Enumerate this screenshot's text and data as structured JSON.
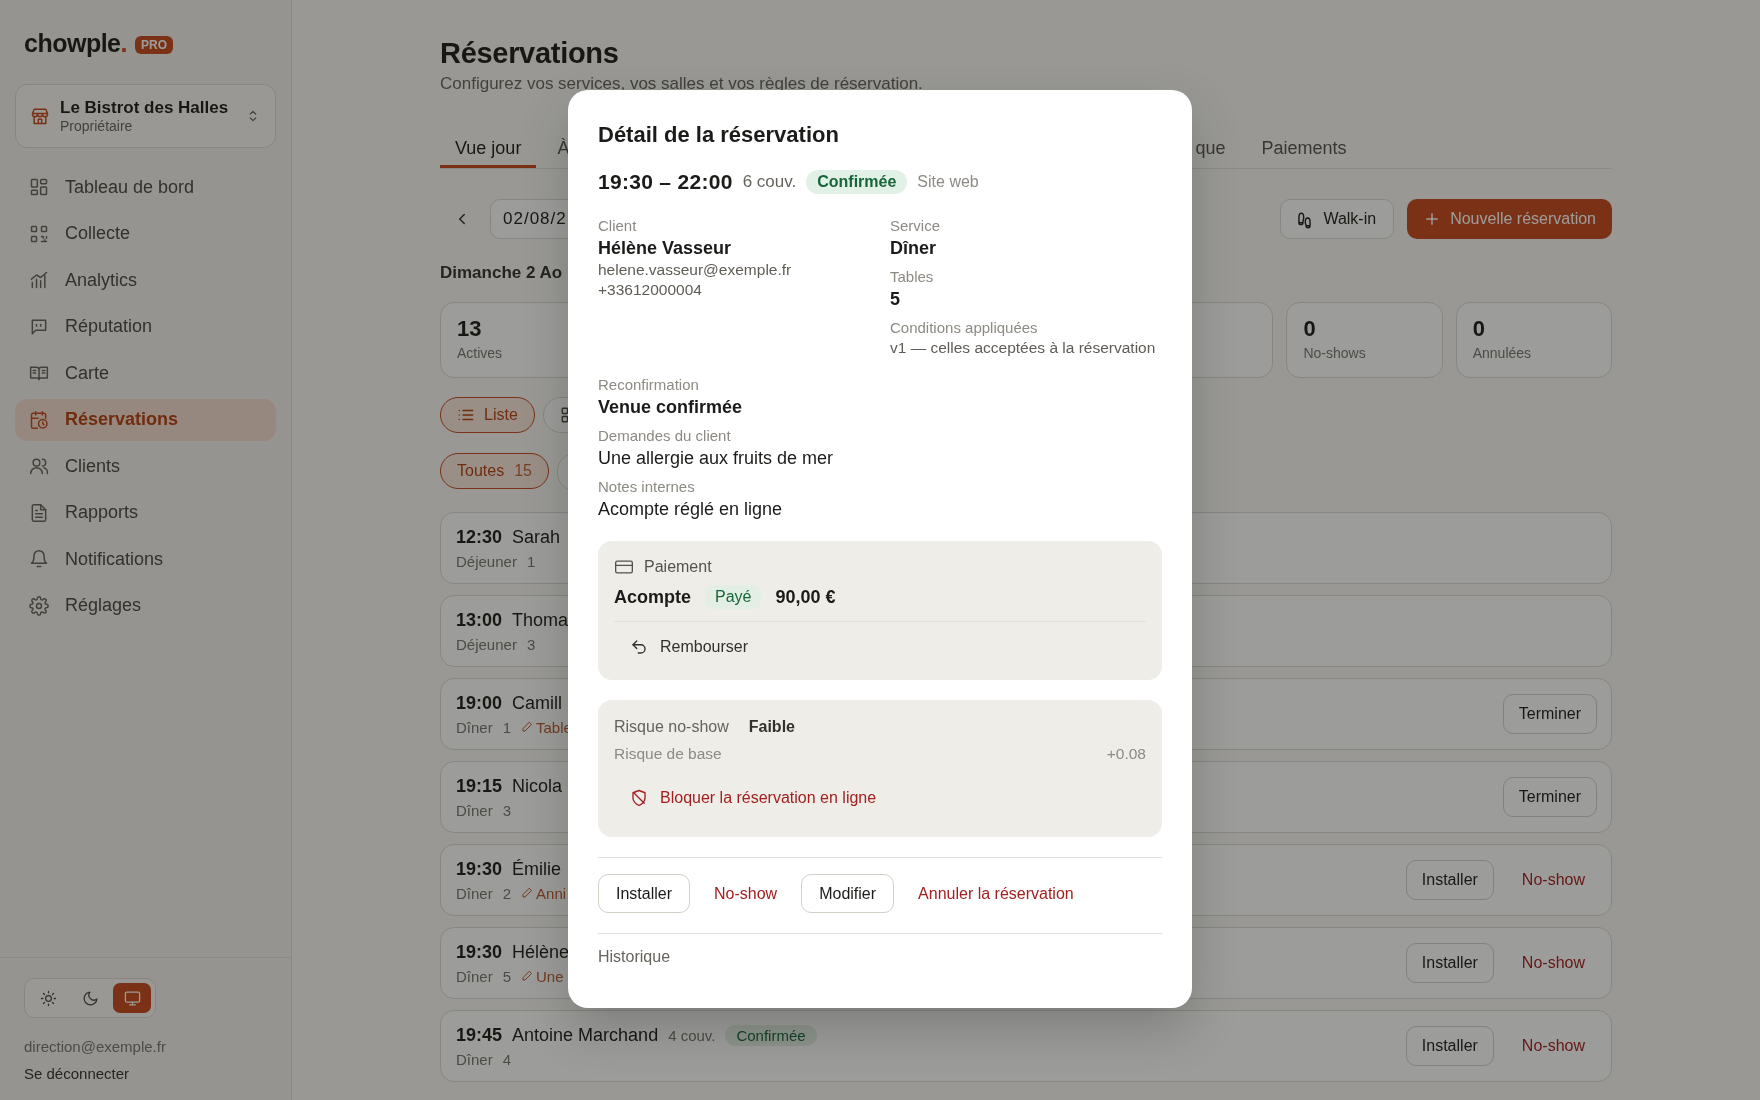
{
  "sidebar": {
    "logo": "chowple.",
    "logo_badge": "PRO",
    "venue": {
      "name": "Le Bistrot des Halles",
      "role": "Propriétaire"
    },
    "items": [
      {
        "label": "Tableau de bord",
        "selected": false
      },
      {
        "label": "Collecte",
        "selected": false
      },
      {
        "label": "Analytics",
        "selected": false
      },
      {
        "label": "Réputation",
        "selected": false
      },
      {
        "label": "Carte",
        "selected": false
      },
      {
        "label": "Réservations",
        "selected": true
      },
      {
        "label": "Clients",
        "selected": false
      },
      {
        "label": "Rapports",
        "selected": false
      },
      {
        "label": "Notifications",
        "selected": false
      },
      {
        "label": "Réglages",
        "selected": false
      }
    ],
    "theme": [
      {
        "selected": false
      },
      {
        "selected": false
      },
      {
        "selected": true
      }
    ],
    "email": "direction@exemple.fr",
    "logout": "Se déconnecter"
  },
  "main": {
    "title": "Réservations",
    "subtitle": "Configurez vos services, vos salles et vos règles de réservation.",
    "tabs": [
      {
        "label": "Vue jour",
        "selected": true
      },
      {
        "label": "À",
        "selected": false
      },
      {
        "label": "que",
        "selected": false
      },
      {
        "label": "Paiements",
        "selected": false
      }
    ],
    "date": "02/08/2",
    "walk_in": "Walk-in",
    "new_button": "Nouvelle réservation",
    "day": "Dimanche 2 Ao",
    "stats": [
      {
        "value": "13",
        "label": "Actives"
      },
      {
        "value": "0",
        "label": "No-shows"
      },
      {
        "value": "0",
        "label": "Annulées"
      }
    ],
    "views": [
      {
        "label": "Liste",
        "selected": true
      },
      {
        "selected": false
      }
    ],
    "filters": [
      {
        "label": "Toutes",
        "count": "15",
        "selected": true
      }
    ],
    "rows": [
      {
        "time": "12:30",
        "name": "Sarah",
        "service": "Déjeuner",
        "covers": "1",
        "actions": []
      },
      {
        "time": "13:00",
        "name": "Thoma",
        "service": "Déjeuner",
        "covers": "3",
        "actions": []
      },
      {
        "time": "19:00",
        "name": "Camill",
        "service": "Dîner",
        "covers": "1",
        "note": "Table",
        "actions": [
          {
            "label": "Terminer",
            "kind": "outline"
          }
        ]
      },
      {
        "time": "19:15",
        "name": "Nicola",
        "service": "Dîner",
        "covers": "3",
        "actions": [
          {
            "label": "Terminer",
            "kind": "outline"
          }
        ]
      },
      {
        "time": "19:30",
        "name": "Émilie",
        "service": "Dîner",
        "covers": "2",
        "note": "Anni",
        "actions": [
          {
            "label": "Installer",
            "kind": "outline"
          },
          {
            "label": "No-show",
            "kind": "danger"
          }
        ]
      },
      {
        "time": "19:30",
        "name": "Hélène",
        "service": "Dîner",
        "covers": "5",
        "note": "Une",
        "actions": [
          {
            "label": "Installer",
            "kind": "outline"
          },
          {
            "label": "No-show",
            "kind": "danger"
          }
        ]
      },
      {
        "time": "19:45",
        "name": "Antoine Marchand",
        "party": "4 couv.",
        "status": "Confirmée",
        "service": "Dîner",
        "covers": "4",
        "actions": [
          {
            "label": "Installer",
            "kind": "outline"
          },
          {
            "label": "No-show",
            "kind": "danger"
          }
        ]
      }
    ]
  },
  "modal": {
    "title": "Détail de la réservation",
    "time": "19:30 – 22:00",
    "party": "6 couv.",
    "status": "Confirmée",
    "source": "Site web",
    "left_fields": [
      {
        "label": "Client",
        "value": "Hélène Vasseur",
        "kind": "strong",
        "extra": [
          "helene.vasseur@exemple.fr",
          "+33612000004"
        ]
      }
    ],
    "right_fields": [
      {
        "label": "Service",
        "value": "Dîner",
        "kind": "strong"
      },
      {
        "label": "Tables",
        "value": "5",
        "kind": "strong"
      },
      {
        "label": "Conditions appliquées",
        "value": "v1 — celles acceptées à la réservation",
        "kind": "muted"
      }
    ],
    "fields": [
      {
        "label": "Reconfirmation",
        "value": "Venue confirmée",
        "kind": "strong"
      },
      {
        "label": "Demandes du client",
        "value": "Une allergie aux fruits de mer",
        "kind": "plain"
      },
      {
        "label": "Notes internes",
        "value": "Acompte réglé en ligne",
        "kind": "plain"
      }
    ],
    "payment": {
      "title": "Paiement",
      "label": "Acompte",
      "status": "Payé",
      "amount": "90,00 €",
      "action": "Rembourser"
    },
    "risk": {
      "label": "Risque no-show",
      "level_text": "Faible",
      "factors": [
        {
          "label": "Risque de base",
          "value": "+0.08"
        }
      ],
      "action": "Bloquer la réservation en ligne"
    },
    "actions": [
      {
        "label": "Installer",
        "kind": "outline"
      },
      {
        "label": "No-show",
        "kind": "danger"
      },
      {
        "label": "Modifier",
        "kind": "outline"
      },
      {
        "label": "Annuler la réservation",
        "kind": "danger"
      }
    ],
    "history_title": "Historique"
  }
}
